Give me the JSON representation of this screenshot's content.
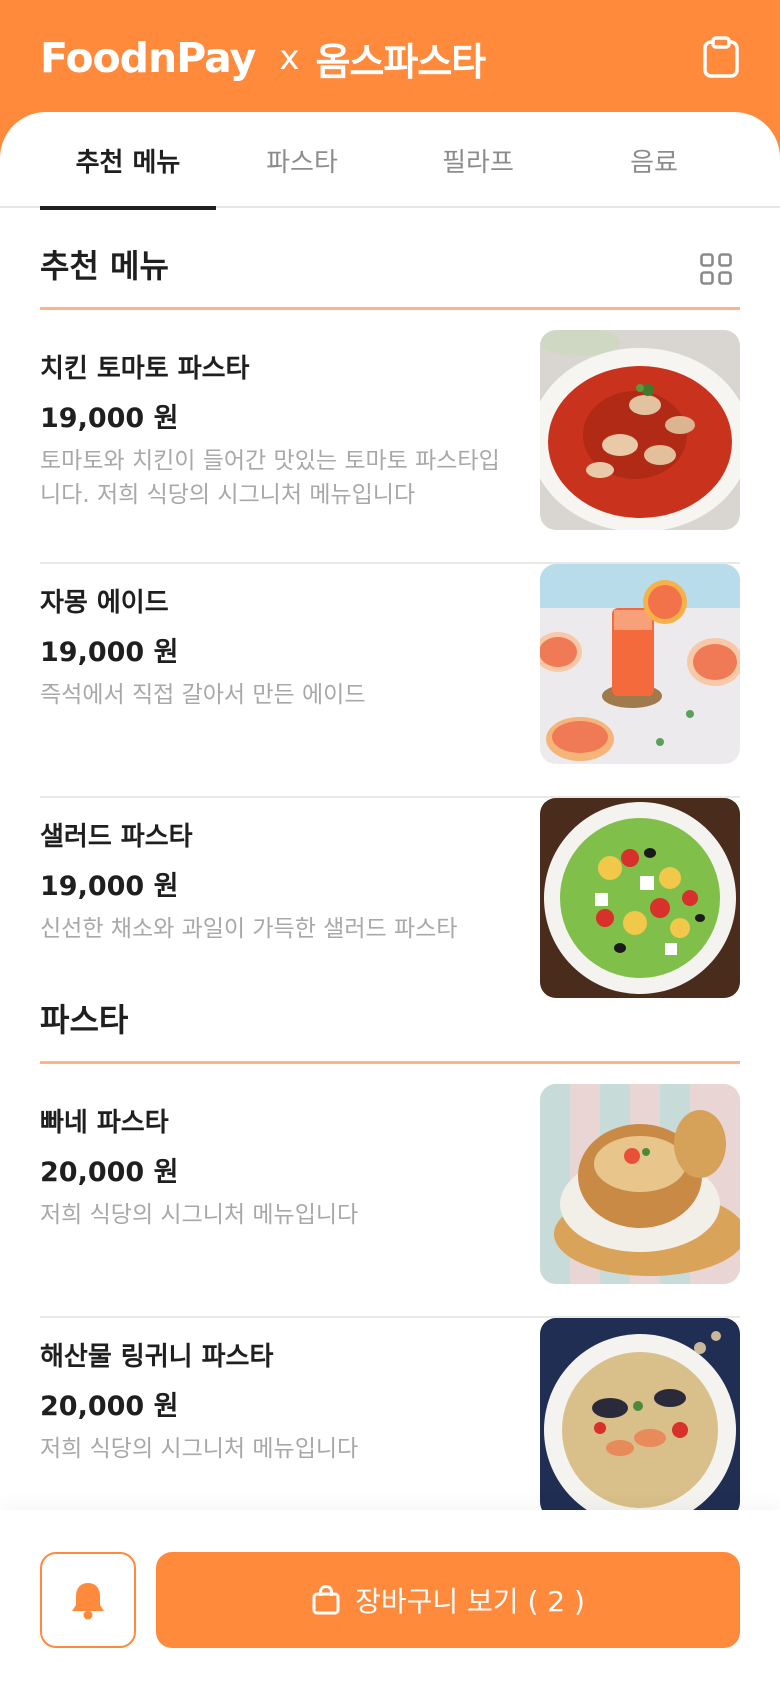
{
  "header": {
    "brand": "FoodnPay",
    "separator": "x",
    "store": "옴스파스타",
    "order_icon": "clipboard-icon"
  },
  "tabs": [
    {
      "label": "추천 메뉴",
      "active": true
    },
    {
      "label": "파스타",
      "active": false
    },
    {
      "label": "필라프",
      "active": false
    },
    {
      "label": "음료",
      "active": false
    }
  ],
  "sections": [
    {
      "title": "추천 메뉴",
      "view_icon": "grid-view-icon",
      "items": [
        {
          "name": "치킨 토마토 파스타",
          "price": "19,000 원",
          "description": "토마토와 치킨이 들어간 맛있는 토마토 파스타입니다. 저희 식당의 시그니처 메뉴입니다",
          "image": "tomato-pasta-photo"
        },
        {
          "name": "자몽 에이드",
          "price": "19,000 원",
          "description": "즉석에서 직접 갈아서 만든 에이드",
          "image": "grapefruit-ade-photo"
        },
        {
          "name": "샐러드 파스타",
          "price": "19,000 원",
          "description": "신선한 채소와 과일이 가득한 샐러드 파스타",
          "image": "salad-pasta-photo"
        }
      ]
    },
    {
      "title": "파스타",
      "items": [
        {
          "name": "빠네 파스타",
          "price": "20,000 원",
          "description": "저희 식당의 시그니처 메뉴입니다",
          "image": "pane-pasta-photo"
        },
        {
          "name": "해산물 링귀니 파스타",
          "price": "20,000 원",
          "description": "저희 식당의 시그니처 메뉴입니다",
          "image": "seafood-linguine-photo"
        }
      ]
    }
  ],
  "bottom_bar": {
    "bell_icon": "bell-icon",
    "cart_icon": "shopping-bag-icon",
    "cart_label": "장바구니 보기 ( 2 )"
  },
  "colors": {
    "brand": "#ff8a3c",
    "section_underline": "#ffb386",
    "text": "#1f1f1f",
    "muted": "#a8a8a8"
  }
}
